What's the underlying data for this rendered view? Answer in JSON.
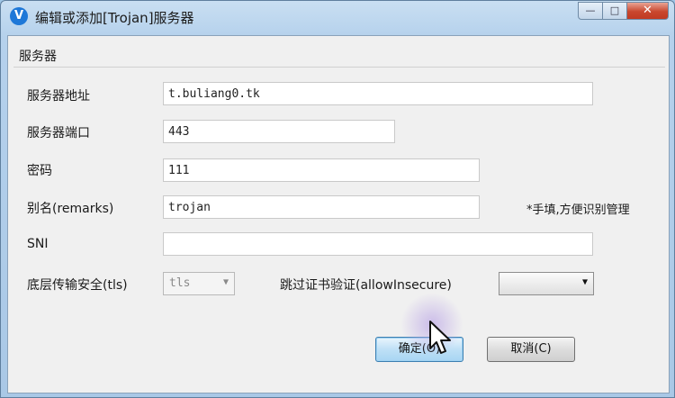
{
  "window": {
    "title": "编辑或添加[Trojan]服务器",
    "app_icon": "V",
    "buttons": {
      "minimize": "—",
      "maximize": "□",
      "close": "✕"
    }
  },
  "form": {
    "group_label": "服务器",
    "address": {
      "label": "服务器地址",
      "value": "t.buliang0.tk"
    },
    "port": {
      "label": "服务器端口",
      "value": "443"
    },
    "password": {
      "label": "密码",
      "value": "111"
    },
    "remarks": {
      "label": "别名(remarks)",
      "value": "trojan",
      "hint": "*手填,方便识别管理"
    },
    "sni": {
      "label": "SNI",
      "value": ""
    },
    "security": {
      "label": "底层传输安全(tls)",
      "value": "tls"
    },
    "allow_insecure": {
      "label": "跳过证书验证(allowInsecure)",
      "value": ""
    }
  },
  "actions": {
    "ok_label": "确定(O)",
    "cancel_label": "取消(C)"
  }
}
